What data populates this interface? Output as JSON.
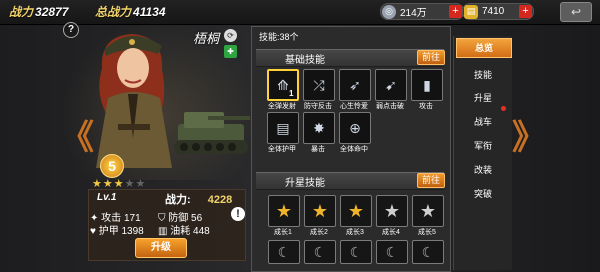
{
  "topbar": {
    "battle_label": "战力",
    "battle_value": "32877",
    "total_label": "总战力",
    "total_value": "41134",
    "silver": "214万",
    "gold": "7410",
    "plus": "+",
    "back_icon": "back-arrow-icon"
  },
  "hero": {
    "help": "?",
    "name": "梧桐",
    "star_filled": "★★★",
    "star_empty": "★★",
    "star_badge": "5",
    "level": "Lv.1",
    "power_label": "战力:",
    "power_value": "4228",
    "stats": {
      "attack": "攻击 171",
      "defense": "防御 56",
      "armor": "护甲 1398",
      "fuel": "油耗 448"
    },
    "upgrade": "升级",
    "alert": "!"
  },
  "nav": {
    "prev": "《",
    "next": "》"
  },
  "skills": {
    "count": "技能:38个",
    "basic_title": "基础技能",
    "goto": "前往",
    "basic": [
      {
        "label": "全弹发射",
        "icon": "missile-icon",
        "glyph": "⟰",
        "active": true,
        "level": "1"
      },
      {
        "label": "防守反击",
        "icon": "shield-strike-icon",
        "glyph": "⤮",
        "active": false,
        "level": ""
      },
      {
        "label": "心生怜爱",
        "icon": "heart-arrow-icon",
        "glyph": "➶",
        "active": false,
        "level": ""
      },
      {
        "label": "弱点击破",
        "icon": "rocket-icon",
        "glyph": "➹",
        "active": false,
        "level": ""
      },
      {
        "label": "攻击",
        "icon": "shell-icon",
        "glyph": "▮",
        "active": false,
        "level": ""
      },
      {
        "label": "全体护甲",
        "icon": "armor-icon",
        "glyph": "▤",
        "active": false,
        "level": ""
      },
      {
        "label": "暴击",
        "icon": "explosion-icon",
        "glyph": "✸",
        "active": false,
        "level": ""
      },
      {
        "label": "全体命中",
        "icon": "crosshair-icon",
        "glyph": "⊕",
        "active": false,
        "level": ""
      }
    ],
    "star_title": "升星技能",
    "star": [
      {
        "label": "成长1"
      },
      {
        "label": "成长2"
      },
      {
        "label": "成长3"
      },
      {
        "label": "成长4"
      },
      {
        "label": "成长5"
      }
    ]
  },
  "tabs": [
    {
      "label": "总览",
      "selected": true
    },
    {
      "label": "技能",
      "selected": false
    },
    {
      "label": "升星",
      "selected": false
    },
    {
      "label": "战车",
      "selected": false
    },
    {
      "label": "军衔",
      "selected": false
    },
    {
      "label": "改装",
      "selected": false
    },
    {
      "label": "突破",
      "selected": false
    }
  ],
  "colors": {
    "accent": "#f3a43c",
    "gold": "#f2d36b",
    "red": "#d4281f"
  }
}
